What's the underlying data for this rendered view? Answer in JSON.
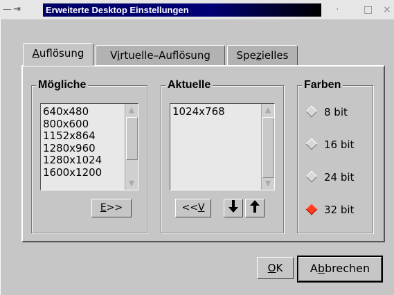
{
  "window": {
    "title": "Erweiterte Desktop Einstellungen",
    "left_glyphs": "— ⇥",
    "dot_glyph": "·",
    "max_glyph": "□",
    "close_glyph": "×"
  },
  "tabs": [
    {
      "label_pre": "",
      "accel": "A",
      "label_post": "uflösung",
      "active": true
    },
    {
      "label_pre": "V",
      "accel": "i",
      "label_post": "rtuelle–Auflösung",
      "active": false
    },
    {
      "label_pre": "Spe",
      "accel": "z",
      "label_post": "ielles",
      "active": false
    }
  ],
  "moegliche": {
    "title": "Mögliche",
    "items": [
      "640x480",
      "800x600",
      "1152x864",
      "1280x960",
      "1280x1024",
      "1600x1200"
    ],
    "add_button": {
      "accel": "E",
      "rest": ">>"
    }
  },
  "aktuelle": {
    "title": "Aktuelle",
    "items": [
      "1024x768"
    ],
    "remove_button": {
      "pre": "<<",
      "accel": "V"
    },
    "down_arrow": "🡇",
    "up_arrow": "🡅"
  },
  "farben": {
    "title": "Farben",
    "options": [
      "8 bit",
      "16 bit",
      "24 bit",
      "32 bit"
    ],
    "selected": "32 bit"
  },
  "buttons": {
    "ok": {
      "accel": "O",
      "rest": "K"
    },
    "cancel": {
      "pre": "A",
      "accel": "b",
      "rest": "brechen"
    }
  },
  "colors": {
    "titlebar": "#000074",
    "background": "#c6c6c6",
    "radio_checked": "#ff3b20"
  }
}
